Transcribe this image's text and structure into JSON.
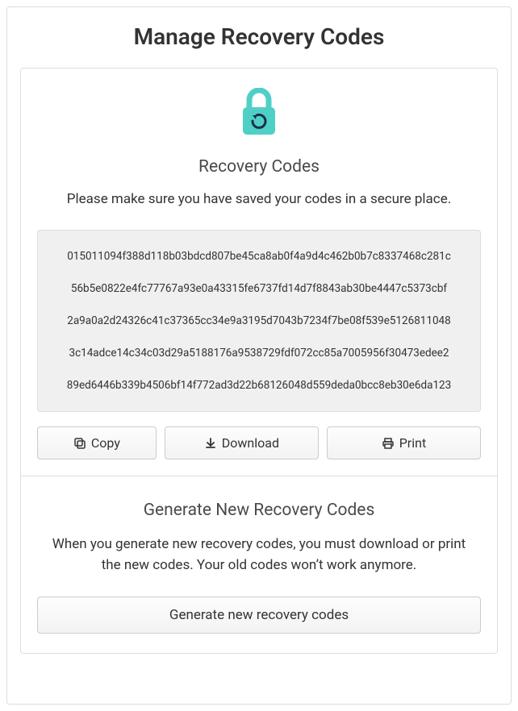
{
  "page_title": "Manage Recovery Codes",
  "recovery": {
    "heading": "Recovery Codes",
    "instructions": "Please make sure you have saved your codes in a secure place.",
    "codes": [
      "015011094f388d118b03bdcd807be45ca8ab0f4a9d4c462b0b7c8337468c281c",
      "56b5e0822e4fc77767a93e0a43315fe6737fd14d7f8843ab30be4447c5373cbf",
      "2a9a0a2d24326c41c37365cc34e9a3195d7043b7234f7be08f539e5126811048",
      "3c14adce14c34c03d29a5188176a9538729fdf072cc85a7005956f30473edee2",
      "89ed6446b339b4506bf14f772ad3d22b68126048d559deda0bcc8eb30e6da123"
    ],
    "buttons": {
      "copy": "Copy",
      "download": "Download",
      "print": "Print"
    }
  },
  "generate": {
    "heading": "Generate New Recovery Codes",
    "note": "When you generate new recovery codes, you must download or print the new codes. Your old codes won’t work anymore.",
    "button": "Generate new recovery codes"
  }
}
